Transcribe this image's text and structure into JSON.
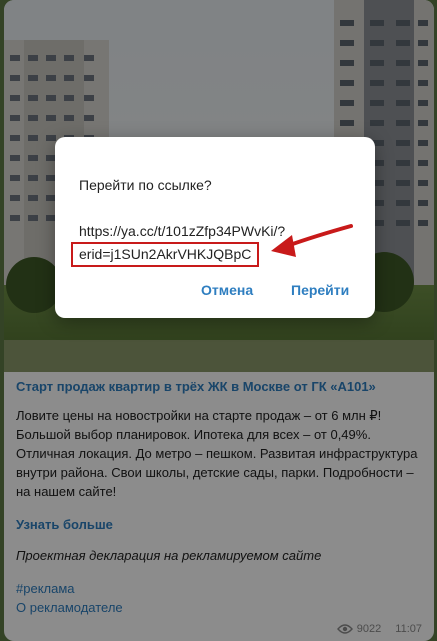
{
  "dialog": {
    "title": "Перейти по ссылке?",
    "url_line1": "https://ya.cc/t/101zZfp34PWvKi/?",
    "url_line2": "erid=j1SUn2AkrVHKJQBpC",
    "cancel_label": "Отмена",
    "go_label": "Перейти"
  },
  "post": {
    "title": "Старт продаж квартир в трёх ЖК в Москве от ГК «А101»",
    "body": "Ловите цены на новостройки на старте продаж – от 6 млн ₽! Большой выбор планировок. Ипотека для всех – от 0,49%. Отличная локация. До метро – пешком. Развитая инфраструктура внутри района. Свои школы, детские сады, парки. Подробности – на нашем сайте!",
    "link_label": "Узнать больше",
    "note": "Проектная декларация на рекламируемом сайте",
    "hashtag": "#реклама",
    "advertiser_link": "О рекламодателе",
    "views": "9022",
    "time": "11:07"
  },
  "colors": {
    "accent": "#2e7ec0",
    "highlight": "#c81a1a"
  },
  "icons": {
    "views": "eye-icon",
    "annotation": "red-arrow-icon"
  }
}
